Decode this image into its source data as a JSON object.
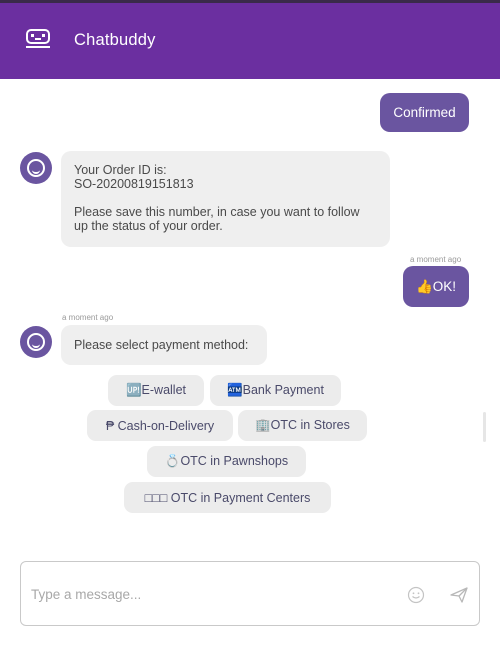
{
  "header": {
    "title": "Chatbuddy",
    "logo_icon": "chatbuddy-logo-icon"
  },
  "colors": {
    "header": "#6b2fa0",
    "user_bubble": "#6a55a0",
    "bot_bubble": "#efefef",
    "chip": "#ececec"
  },
  "messages": {
    "user_confirmed": "Confirmed",
    "bot_order_line1": "Your Order ID is:",
    "bot_order_line2": "SO-20200819151813",
    "bot_order_line3": "Please save this number, in case you want to follow",
    "bot_order_line4": "up the status of your order.",
    "ts_user_ok": "a moment ago",
    "user_ok": "👍OK!",
    "ts_bot_payment": "a moment ago",
    "bot_payment_prompt": "Please select payment method:"
  },
  "payment_options": [
    "🆙E-wallet",
    "🏧Bank Payment",
    "₱ Cash-on-Delivery",
    "🏢OTC in Stores",
    "💍OTC in Pawnshops",
    "□□□ OTC in Payment Centers"
  ],
  "composer": {
    "placeholder": "Type a message...",
    "emoji_icon": "smiley-icon",
    "send_icon": "send-icon"
  }
}
